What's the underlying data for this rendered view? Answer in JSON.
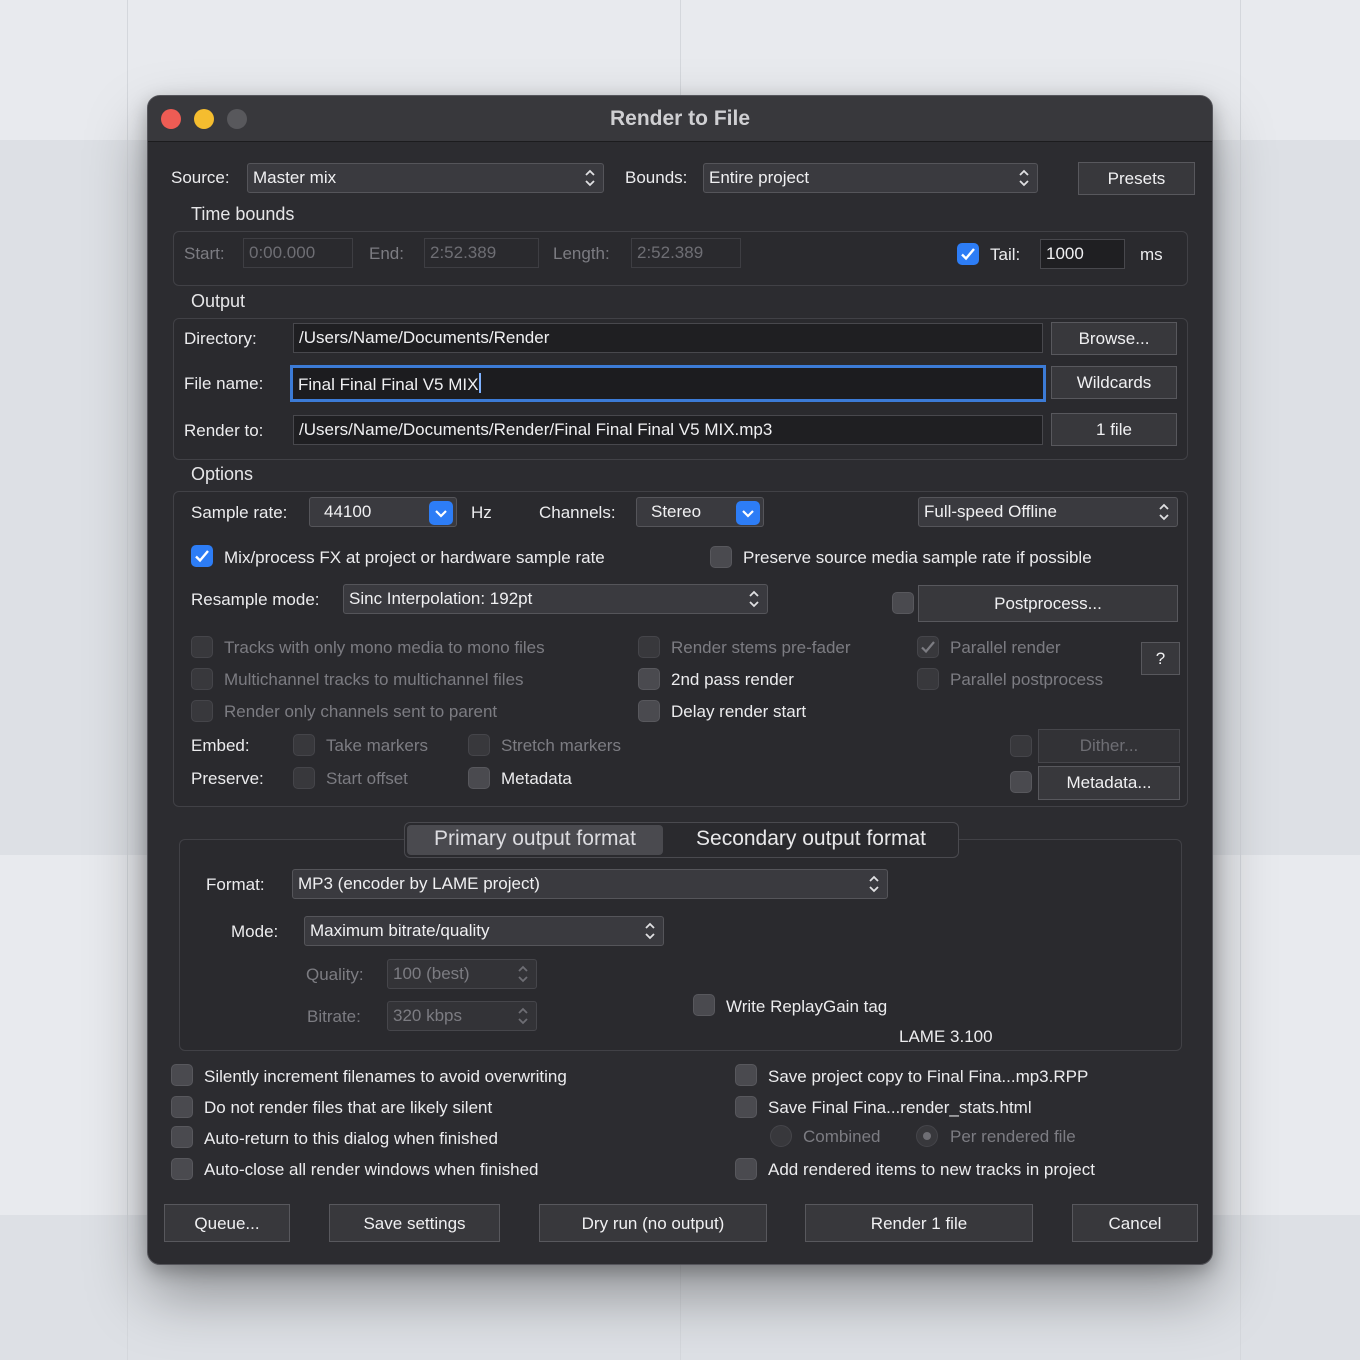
{
  "window": {
    "title": "Render to File"
  },
  "source": {
    "label": "Source:",
    "value": "Master mix"
  },
  "bounds": {
    "label": "Bounds:",
    "value": "Entire project"
  },
  "presets_button": "Presets",
  "time_bounds": {
    "heading": "Time bounds",
    "start_label": "Start:",
    "start_value": "0:00.000",
    "end_label": "End:",
    "end_value": "2:52.389",
    "length_label": "Length:",
    "length_value": "2:52.389",
    "tail_label": "Tail:",
    "tail_checked": true,
    "tail_value": "1000",
    "tail_unit": "ms"
  },
  "output": {
    "heading": "Output",
    "directory_label": "Directory:",
    "directory_value": "/Users/Name/Documents/Render",
    "browse_button": "Browse...",
    "filename_label": "File name:",
    "filename_value": "Final Final Final V5 MIX",
    "wildcards_button": "Wildcards",
    "render_to_label": "Render to:",
    "render_to_value": "/Users/Name/Documents/Render/Final Final Final V5 MIX.mp3",
    "files_button": "1 file"
  },
  "options": {
    "heading": "Options",
    "sample_rate_label": "Sample rate:",
    "sample_rate_value": "44100",
    "hz_label": "Hz",
    "channels_label": "Channels:",
    "channels_value": "Stereo",
    "render_speed_value": "Full-speed Offline",
    "mix_fx_label": "Mix/process FX at project or hardware sample rate",
    "preserve_sr_label": "Preserve source media sample rate if possible",
    "resample_label": "Resample mode:",
    "resample_value": "Sinc Interpolation: 192pt",
    "postprocess_button": "Postprocess...",
    "mono_label": "Tracks with only mono media to mono files",
    "multichannel_label": "Multichannel tracks to multichannel files",
    "channels_parent_label": "Render only channels sent to parent",
    "stems_prefader_label": "Render stems pre-fader",
    "second_pass_label": "2nd pass render",
    "delay_start_label": "Delay render start",
    "parallel_render_label": "Parallel render",
    "parallel_post_label": "Parallel postprocess",
    "help_button": "?",
    "embed_label": "Embed:",
    "take_markers_label": "Take markers",
    "stretch_markers_label": "Stretch markers",
    "preserve_label": "Preserve:",
    "start_offset_label": "Start offset",
    "metadata_label": "Metadata",
    "dither_button": "Dither...",
    "metadata_button": "Metadata..."
  },
  "format_tabs": {
    "primary": "Primary output format",
    "secondary": "Secondary output format"
  },
  "format": {
    "format_label": "Format:",
    "format_value": "MP3 (encoder by LAME project)",
    "mode_label": "Mode:",
    "mode_value": "Maximum bitrate/quality",
    "quality_label": "Quality:",
    "quality_value": "100 (best)",
    "bitrate_label": "Bitrate:",
    "bitrate_value": "320 kbps",
    "replaygain_label": "Write ReplayGain tag",
    "lame_version": "LAME 3.100"
  },
  "bottom_options": {
    "silently_increment": "Silently increment filenames to avoid overwriting",
    "no_silent": "Do not render files that are likely silent",
    "auto_return": "Auto-return to this dialog when finished",
    "auto_close": "Auto-close all render windows when finished",
    "save_project_copy": "Save project copy to Final Fina...mp3.RPP",
    "save_stats": "Save Final Fina...render_stats.html",
    "combined": "Combined",
    "per_file": "Per rendered file",
    "add_tracks": "Add rendered items to new tracks in project"
  },
  "buttons": {
    "queue": "Queue...",
    "save_settings": "Save settings",
    "dry_run": "Dry run (no output)",
    "render": "Render 1 file",
    "cancel": "Cancel"
  },
  "colors": {
    "accent": "#2d7df6",
    "focus_ring": "#3c7bd6",
    "window_bg": "#2c2c30"
  }
}
